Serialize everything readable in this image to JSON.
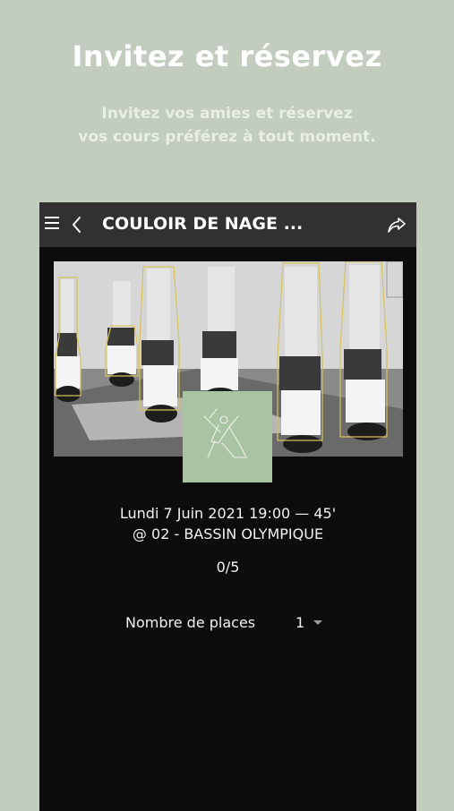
{
  "promo": {
    "title": "Invitez et réservez",
    "subtitle_line1": "Invitez vos amies et réservez",
    "subtitle_line2": "vos cours préférez à tout moment."
  },
  "app_bar": {
    "title": "COULOIR DE NAGE ...",
    "menu_icon": "hamburger-menu-icon",
    "back_icon": "chevron-left-icon",
    "share_icon": "share-arrow-icon"
  },
  "session": {
    "datetime": "Lundi 7 Juin 2021 19:00 — 45'",
    "location": "@ 02 - BASSIN OLYMPIQUE",
    "occupancy": "0/5"
  },
  "booking": {
    "places_label": "Nombre de places",
    "places_value": "1"
  },
  "colors": {
    "background": "#c3cdbf",
    "phone_bg": "#0c0c0c",
    "app_bar_bg": "#313131",
    "badge": "#a9c3a3",
    "outline_accent": "#d7c35a"
  }
}
